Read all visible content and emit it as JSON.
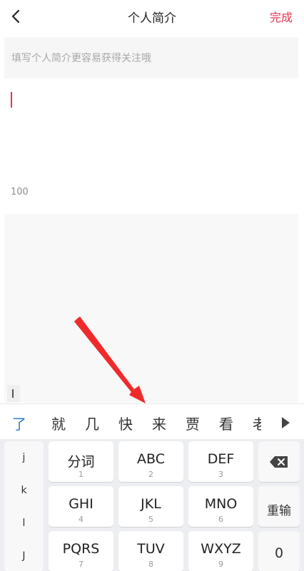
{
  "header": {
    "title": "个人简介",
    "done_label": "完成",
    "back_icon": "chevron-left-icon"
  },
  "bio": {
    "placeholder": "填写个人简介更容易获得关注哦",
    "char_count": "100"
  },
  "candidates": {
    "items": [
      "了",
      "就",
      "几",
      "快",
      "来",
      "贾",
      "看",
      "老"
    ],
    "more_icon": "triangle-right-icon"
  },
  "keyboard": {
    "side_letters": [
      "j",
      "k",
      "l",
      "J"
    ],
    "rows": [
      [
        {
          "main": "分词",
          "sub": "1"
        },
        {
          "main": "ABC",
          "sub": "2"
        },
        {
          "main": "DEF",
          "sub": "3"
        }
      ],
      [
        {
          "main": "GHI",
          "sub": "4"
        },
        {
          "main": "JKL",
          "sub": "5"
        },
        {
          "main": "MNO",
          "sub": "6"
        }
      ],
      [
        {
          "main": "PQRS",
          "sub": "7"
        },
        {
          "main": "TUV",
          "sub": "8"
        },
        {
          "main": "WXYZ",
          "sub": "9"
        }
      ]
    ],
    "backspace_icon": "backspace-icon",
    "reenter_label": "重输",
    "zero_label": "0"
  },
  "colors": {
    "accent": "#e5324f",
    "candidate_highlight": "#2e7bd6",
    "annotation_arrow": "#f02a2a"
  }
}
